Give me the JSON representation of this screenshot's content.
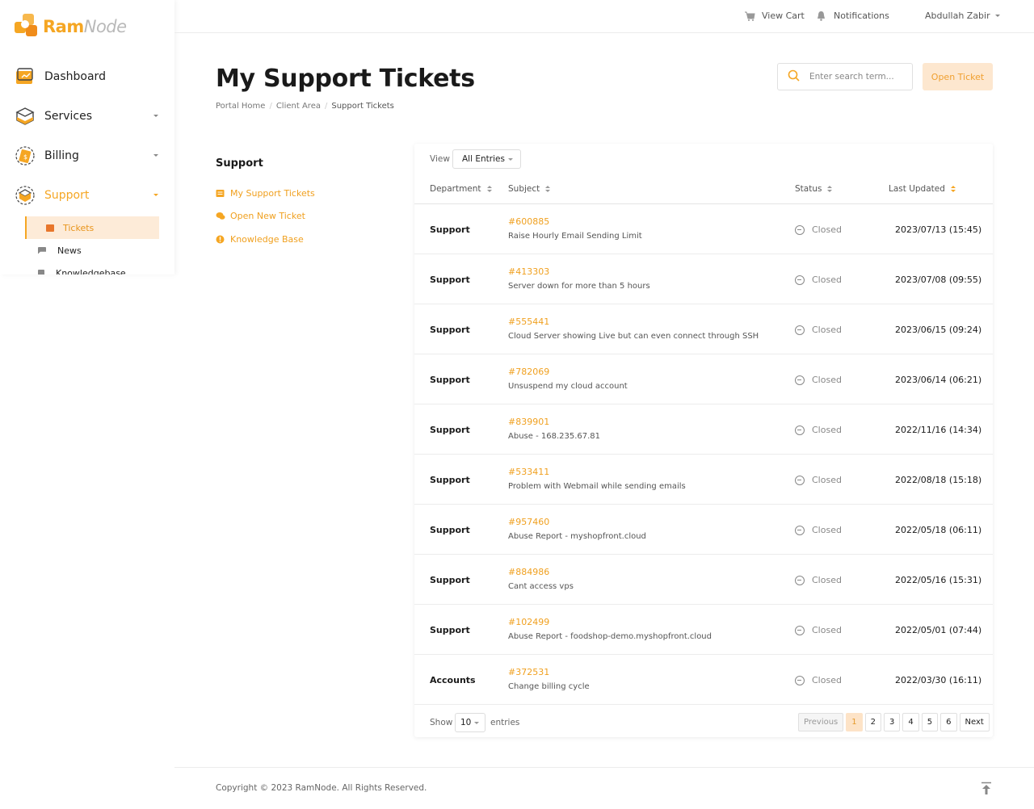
{
  "brand": {
    "name_part1": "Ram",
    "name_part2": "Node",
    "color": "#f5a623"
  },
  "sidebar": {
    "items": [
      {
        "label": "Dashboard",
        "icon": "dashboard-icon"
      },
      {
        "label": "Services",
        "icon": "services-icon"
      },
      {
        "label": "Billing",
        "icon": "billing-icon"
      },
      {
        "label": "Support",
        "icon": "support-icon"
      }
    ],
    "subitems": [
      {
        "label": "Tickets",
        "icon": "inbox-icon"
      },
      {
        "label": "News",
        "icon": "flag-icon"
      },
      {
        "label": "Knowledgebase",
        "icon": "book-icon"
      }
    ]
  },
  "topbar": {
    "view_cart": "View Cart",
    "notifications": "Notifications",
    "user_name": "Abdullah Zabir"
  },
  "page": {
    "title": "My Support Tickets",
    "breadcrumb": [
      "Portal Home",
      "Client Area",
      "Support Tickets"
    ],
    "search_placeholder": "Enter search term...",
    "open_ticket": "Open Ticket"
  },
  "side_panel": {
    "title": "Support",
    "links": [
      "My Support Tickets",
      "Open New Ticket",
      "Knowledge Base"
    ]
  },
  "table": {
    "view_label": "View",
    "view_value": "All Entries",
    "columns": [
      "Department",
      "Subject",
      "Status",
      "Last Updated"
    ],
    "rows": [
      {
        "department": "Support",
        "id": "#600885",
        "subject": "Raise Hourly Email Sending Limit",
        "status": "Closed",
        "updated": "2023/07/13 (15:45)"
      },
      {
        "department": "Support",
        "id": "#413303",
        "subject": "Server down for more than 5 hours",
        "status": "Closed",
        "updated": "2023/07/08 (09:55)"
      },
      {
        "department": "Support",
        "id": "#555441",
        "subject": "Cloud Server showing Live but can even connect through SSH",
        "status": "Closed",
        "updated": "2023/06/15 (09:24)"
      },
      {
        "department": "Support",
        "id": "#782069",
        "subject": "Unsuspend my cloud account",
        "status": "Closed",
        "updated": "2023/06/14 (06:21)"
      },
      {
        "department": "Support",
        "id": "#839901",
        "subject": "Abuse - 168.235.67.81",
        "status": "Closed",
        "updated": "2022/11/16 (14:34)"
      },
      {
        "department": "Support",
        "id": "#533411",
        "subject": "Problem with Webmail while sending emails",
        "status": "Closed",
        "updated": "2022/08/18 (15:18)"
      },
      {
        "department": "Support",
        "id": "#957460",
        "subject": "Abuse Report - myshopfront.cloud",
        "status": "Closed",
        "updated": "2022/05/18 (06:11)"
      },
      {
        "department": "Support",
        "id": "#884986",
        "subject": "Cant access vps",
        "status": "Closed",
        "updated": "2022/05/16 (15:31)"
      },
      {
        "department": "Support",
        "id": "#102499",
        "subject": "Abuse Report - foodshop-demo.myshopfront.cloud",
        "status": "Closed",
        "updated": "2022/05/01 (07:44)"
      },
      {
        "department": "Accounts",
        "id": "#372531",
        "subject": "Change billing cycle",
        "status": "Closed",
        "updated": "2022/03/30 (16:11)"
      }
    ],
    "show_label": "Show",
    "page_length": "10",
    "entries_label": "entries",
    "pagination": {
      "previous": "Previous",
      "pages": [
        "1",
        "2",
        "3",
        "4",
        "5",
        "6"
      ],
      "current": "1",
      "next": "Next"
    }
  },
  "footer": {
    "copyright": "Copyright © 2023 RamNode. All Rights Reserved."
  }
}
